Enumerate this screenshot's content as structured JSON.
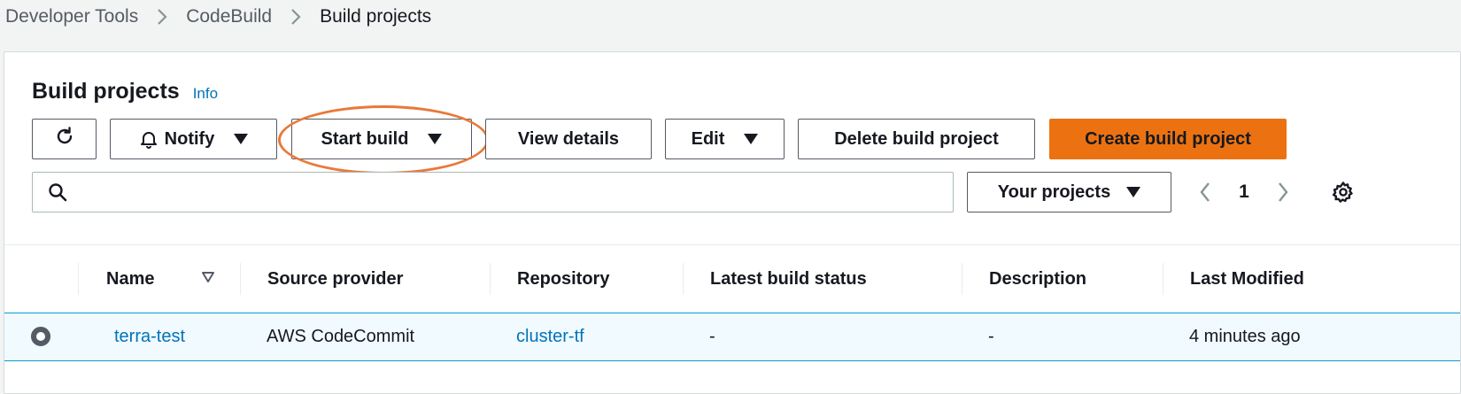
{
  "breadcrumb": {
    "items": [
      "Developer Tools",
      "CodeBuild",
      "Build projects"
    ]
  },
  "panel": {
    "title": "Build projects",
    "info_label": "Info"
  },
  "toolbar": {
    "refresh_icon": "refresh-icon",
    "notify_label": "Notify",
    "start_build_label": "Start build",
    "view_details_label": "View details",
    "edit_label": "Edit",
    "delete_label": "Delete build project",
    "create_label": "Create build project"
  },
  "search": {
    "value": "",
    "placeholder": ""
  },
  "filter": {
    "selected": "Your projects"
  },
  "pagination": {
    "current_page": "1"
  },
  "table": {
    "columns": [
      "Name",
      "Source provider",
      "Repository",
      "Latest build status",
      "Description",
      "Last Modified"
    ],
    "rows": [
      {
        "name": "terra-test",
        "source_provider": "AWS CodeCommit",
        "repository": "cluster-tf",
        "latest_build_status": "-",
        "description": "-",
        "last_modified": "4 minutes ago",
        "selected": true
      }
    ]
  },
  "colors": {
    "primary_button": "#ec7211",
    "link": "#0073bb",
    "highlight_ring": "#e8793a",
    "selected_row_bg": "#f1faff",
    "selected_row_border": "#00a1c9"
  }
}
